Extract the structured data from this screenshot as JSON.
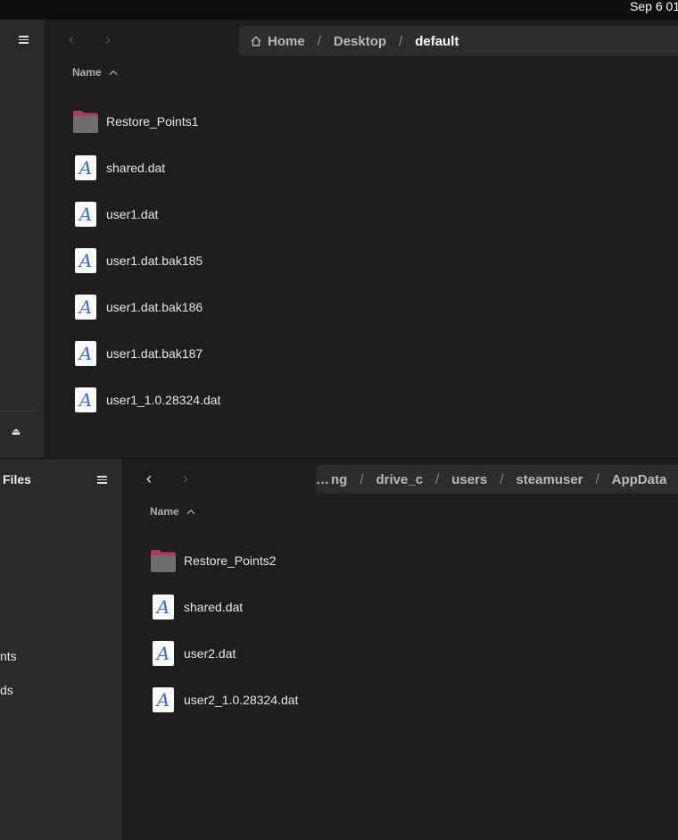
{
  "topbar": {
    "clock": "Sep 6  01:"
  },
  "window1": {
    "breadcrumbs": [
      {
        "label": "Home",
        "icon": "home-icon"
      },
      {
        "label": "Desktop"
      },
      {
        "label": "default"
      }
    ],
    "column_name": "Name",
    "files": [
      {
        "name": "Restore_Points1",
        "type": "folder"
      },
      {
        "name": "shared.dat",
        "type": "text"
      },
      {
        "name": "user1.dat",
        "type": "text"
      },
      {
        "name": "user1.dat.bak185",
        "type": "text"
      },
      {
        "name": "user1.dat.bak186",
        "type": "text"
      },
      {
        "name": "user1.dat.bak187",
        "type": "text"
      },
      {
        "name": "user1_1.0.28324.dat",
        "type": "text"
      }
    ]
  },
  "window2": {
    "app_title": "Files",
    "sidebar_fragments": [
      "nts",
      "ds"
    ],
    "breadcrumbs": {
      "ellipsis": "…",
      "items": [
        "ng",
        "drive_c",
        "users",
        "steamuser",
        "AppData"
      ]
    },
    "column_name": "Name",
    "files": [
      {
        "name": "Restore_Points2",
        "type": "folder"
      },
      {
        "name": "shared.dat",
        "type": "text"
      },
      {
        "name": "user2.dat",
        "type": "text"
      },
      {
        "name": "user2_1.0.28324.dat",
        "type": "text"
      }
    ]
  },
  "colors": {
    "folder_tab": "#b0395f",
    "folder_body": "#6e6e6e",
    "text_icon_glyph": "#3d6ec9"
  }
}
